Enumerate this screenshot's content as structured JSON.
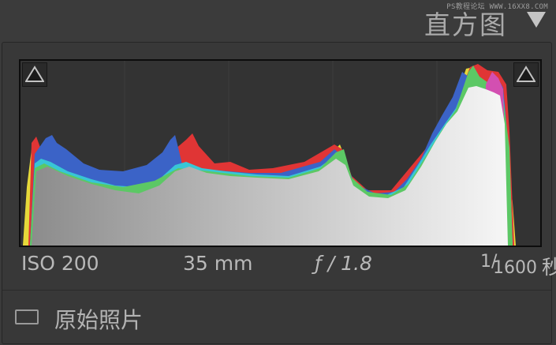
{
  "watermark": "PS教程论坛 WWW.16XX8.COM",
  "header": {
    "title": "直方图",
    "collapse_icon": "triangle-down-icon"
  },
  "histogram": {
    "shadow_clip_icon": "triangle-up-icon",
    "highlight_clip_icon": "triangle-up-icon",
    "colors": {
      "blue": "#3b63c7",
      "cyan": "#38c6d6",
      "yellow": "#e6d93a",
      "red": "#e03535",
      "magenta": "#d34fb1",
      "green": "#5cc865",
      "luminance_dark": "#8f8f8f",
      "luminance_light": "#f4f4f4"
    }
  },
  "exif": {
    "iso": "ISO 200",
    "focal_length": "35 mm",
    "aperture": "ƒ / 1.8",
    "shutter_num": "1",
    "shutter_slash": "/",
    "shutter_den": "1600",
    "shutter_unit": "秒"
  },
  "original_photo": {
    "label": "原始照片",
    "checked": false
  }
}
